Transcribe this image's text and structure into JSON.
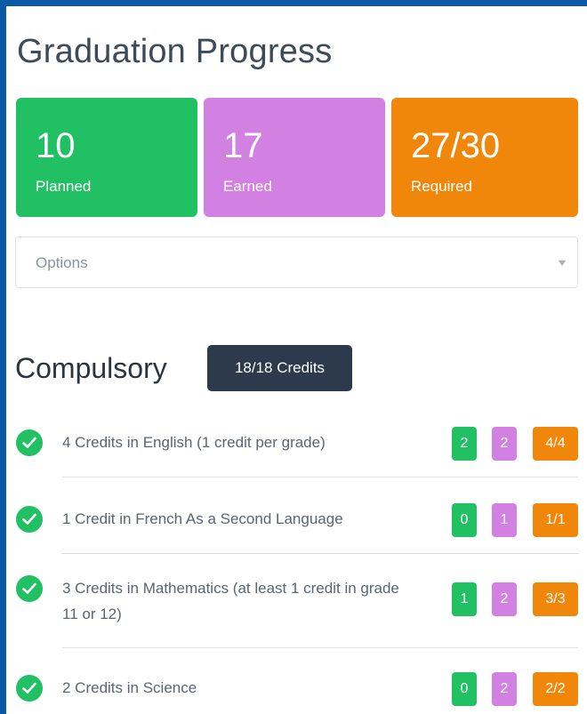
{
  "page": {
    "title": "Graduation Progress"
  },
  "stats": [
    {
      "value": "10",
      "label": "Planned",
      "color": "#21c063"
    },
    {
      "value": "17",
      "label": "Earned",
      "color": "#d380e3"
    },
    {
      "value": "27/30",
      "label": "Required",
      "color": "#f0860a"
    }
  ],
  "options": {
    "placeholder": "Options"
  },
  "compulsory": {
    "title": "Compulsory",
    "credits": "18/18 Credits",
    "requirements": [
      {
        "text": "4 Credits in English (1 credit per grade)",
        "planned": "2",
        "earned": "2",
        "required": "4/4",
        "complete": true
      },
      {
        "text": "1 Credit in French As a Second Language",
        "planned": "0",
        "earned": "1",
        "required": "1/1",
        "complete": true
      },
      {
        "text": "3 Credits in Mathematics (at least 1 credit in grade 11 or 12)",
        "planned": "1",
        "earned": "2",
        "required": "3/3",
        "complete": true
      },
      {
        "text": "2 Credits in Science",
        "planned": "0",
        "earned": "2",
        "required": "2/2",
        "complete": true
      }
    ]
  },
  "colors": {
    "background": "#0b5aa8",
    "badge_dark": "#2c3a4c",
    "check": "#21c063"
  }
}
